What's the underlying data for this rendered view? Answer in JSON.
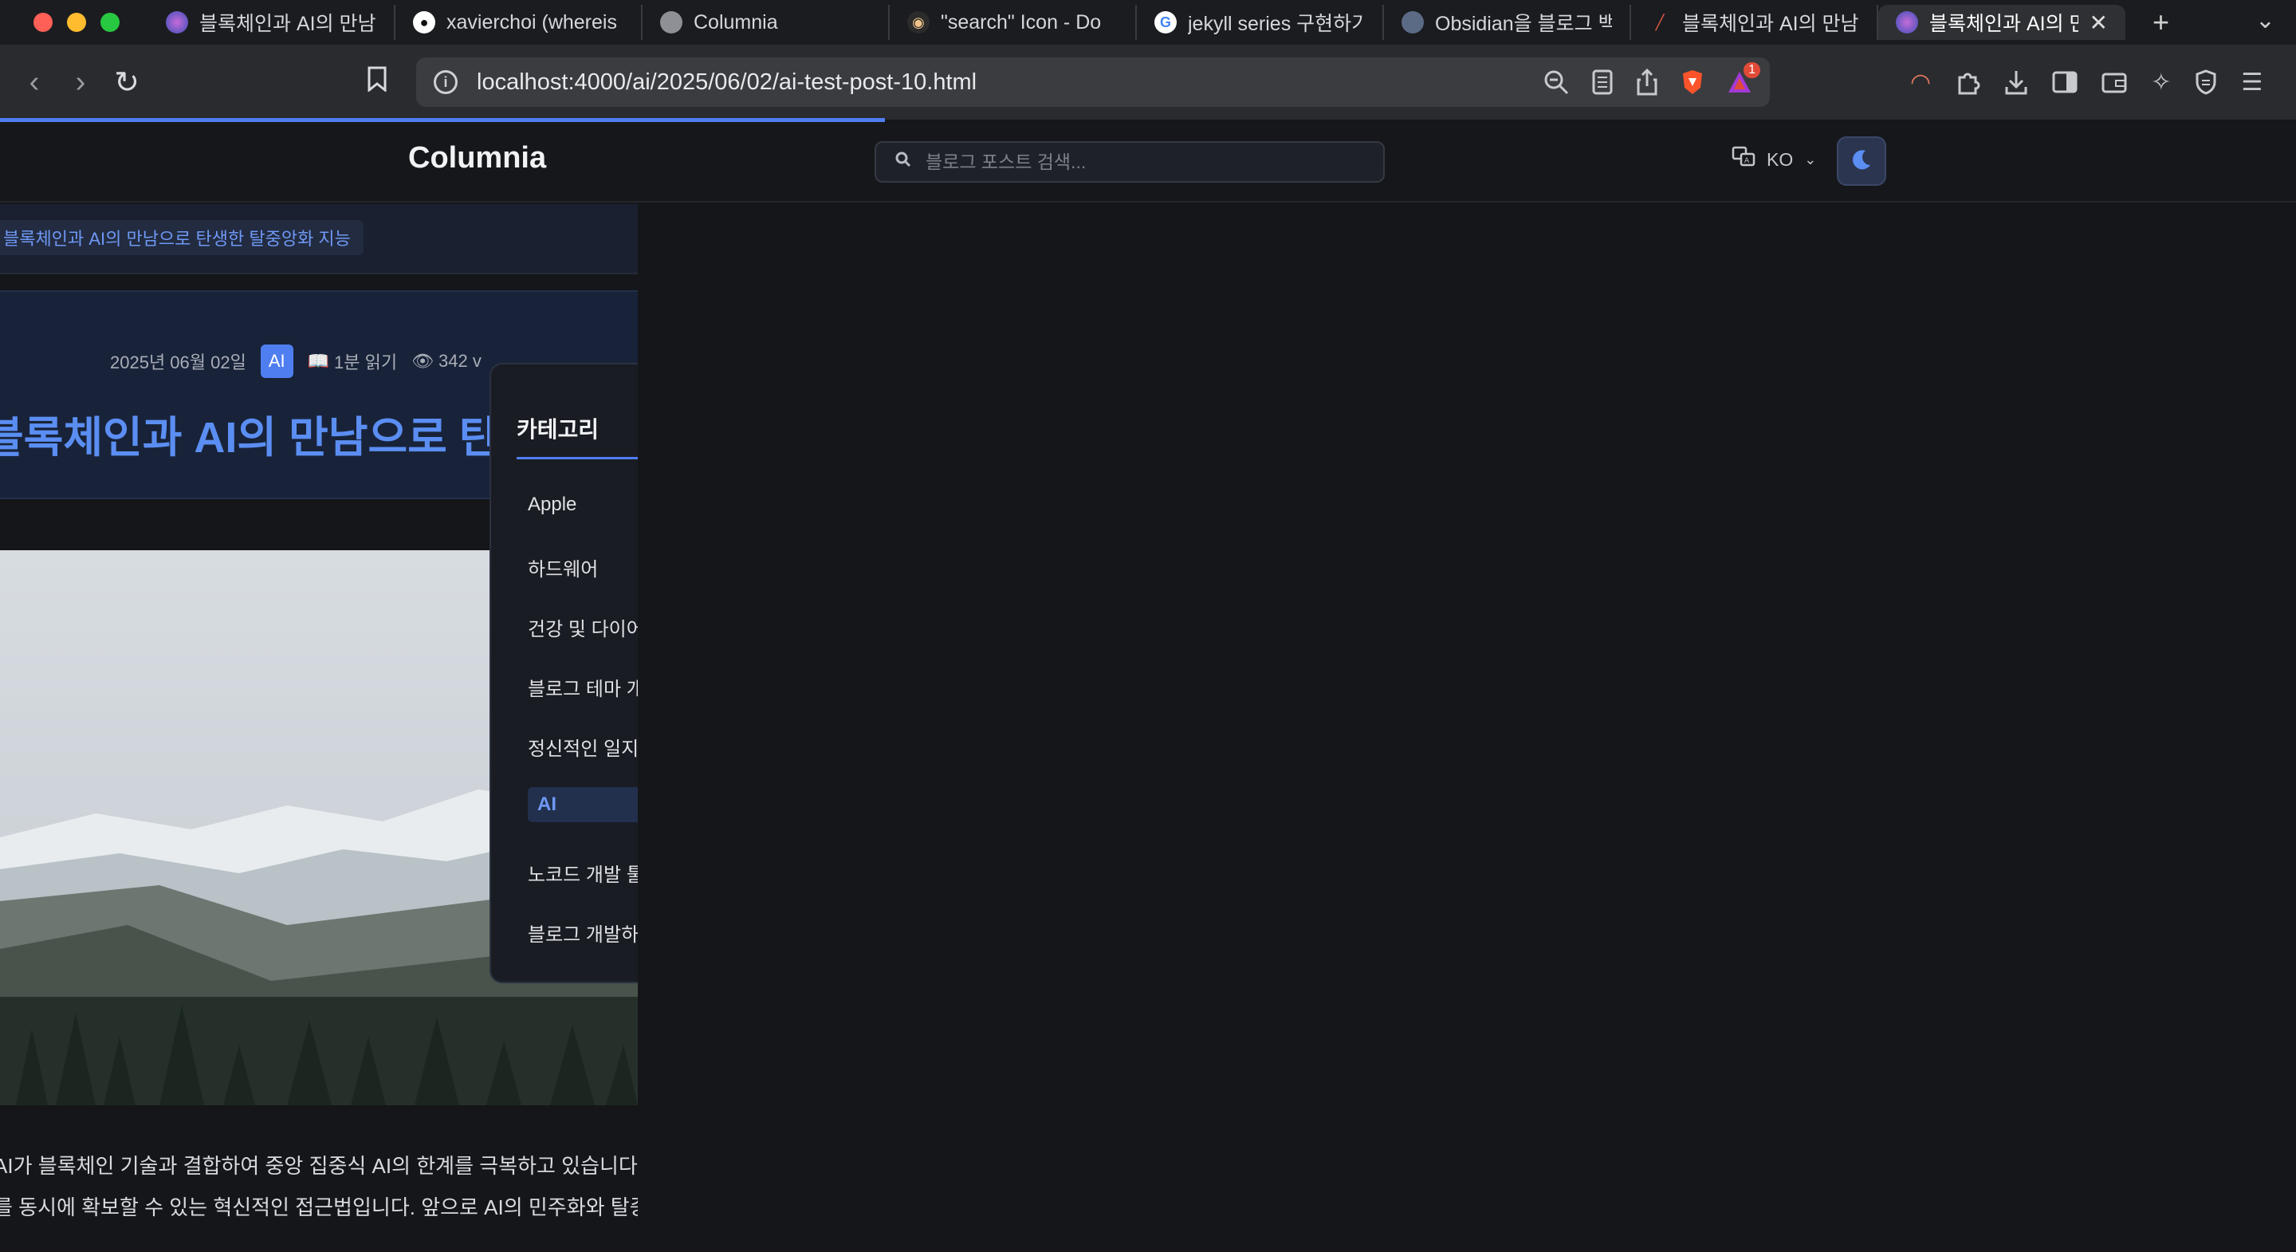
{
  "browser": {
    "tabs": [
      {
        "title": "블록체인과 AI의 만남으",
        "favicon": "globe-icon"
      },
      {
        "title": "xavierchoi (whereis",
        "favicon": "github-icon"
      },
      {
        "title": "Columnia",
        "favicon": "globe-icon"
      },
      {
        "title": "\"search\" Icon - Do",
        "favicon": "glyph-icon"
      },
      {
        "title": "jekyll series 구현하기",
        "favicon": "google-icon"
      },
      {
        "title": "Obsidian을 블로그 백",
        "favicon": "obsidian-icon"
      },
      {
        "title": "블록체인과 AI의 만남으",
        "favicon": "pen-icon"
      },
      {
        "title": "블록체인과 AI의 만남",
        "favicon": "globe-icon",
        "active": true
      }
    ],
    "url": "localhost:4000/ai/2025/06/02/ai-test-post-10.html",
    "notification_count": "1",
    "colors": {
      "accent": "#4f7ef0"
    }
  },
  "site": {
    "logo": "Columnia",
    "search_placeholder": "블로그 포스트 검색...",
    "lang": "KO"
  },
  "post": {
    "breadcrumb": "블록체인과 AI의 만남으로 탄생한 탈중앙화 지능",
    "date": "2025년 06월 02일",
    "category": "AI",
    "read_time": "1분 읽기",
    "views": "342 v",
    "title": "블록체인과 AI의 만남으로 탄생한",
    "body_lines": [
      "AI가 블록체인 기술과 결합하여 중앙 집중식 AI의 한계를 극복하고 있습니다.",
      "를 동시에 확보할 수 있는 혁신적인 접근법입니다. 앞으로 AI의 민주화와 탈중"
    ]
  },
  "categories": {
    "heading": "카테고리",
    "items": [
      {
        "label": "Apple"
      },
      {
        "label": "하드웨어"
      },
      {
        "label": "건강 및 다이어트"
      },
      {
        "label": "블로그 테마 개발"
      },
      {
        "label": "정신적인 일지"
      },
      {
        "label": "AI",
        "selected": true
      },
      {
        "label": "노코드 개발 툴"
      },
      {
        "label": "블로그 개발하기"
      }
    ]
  }
}
